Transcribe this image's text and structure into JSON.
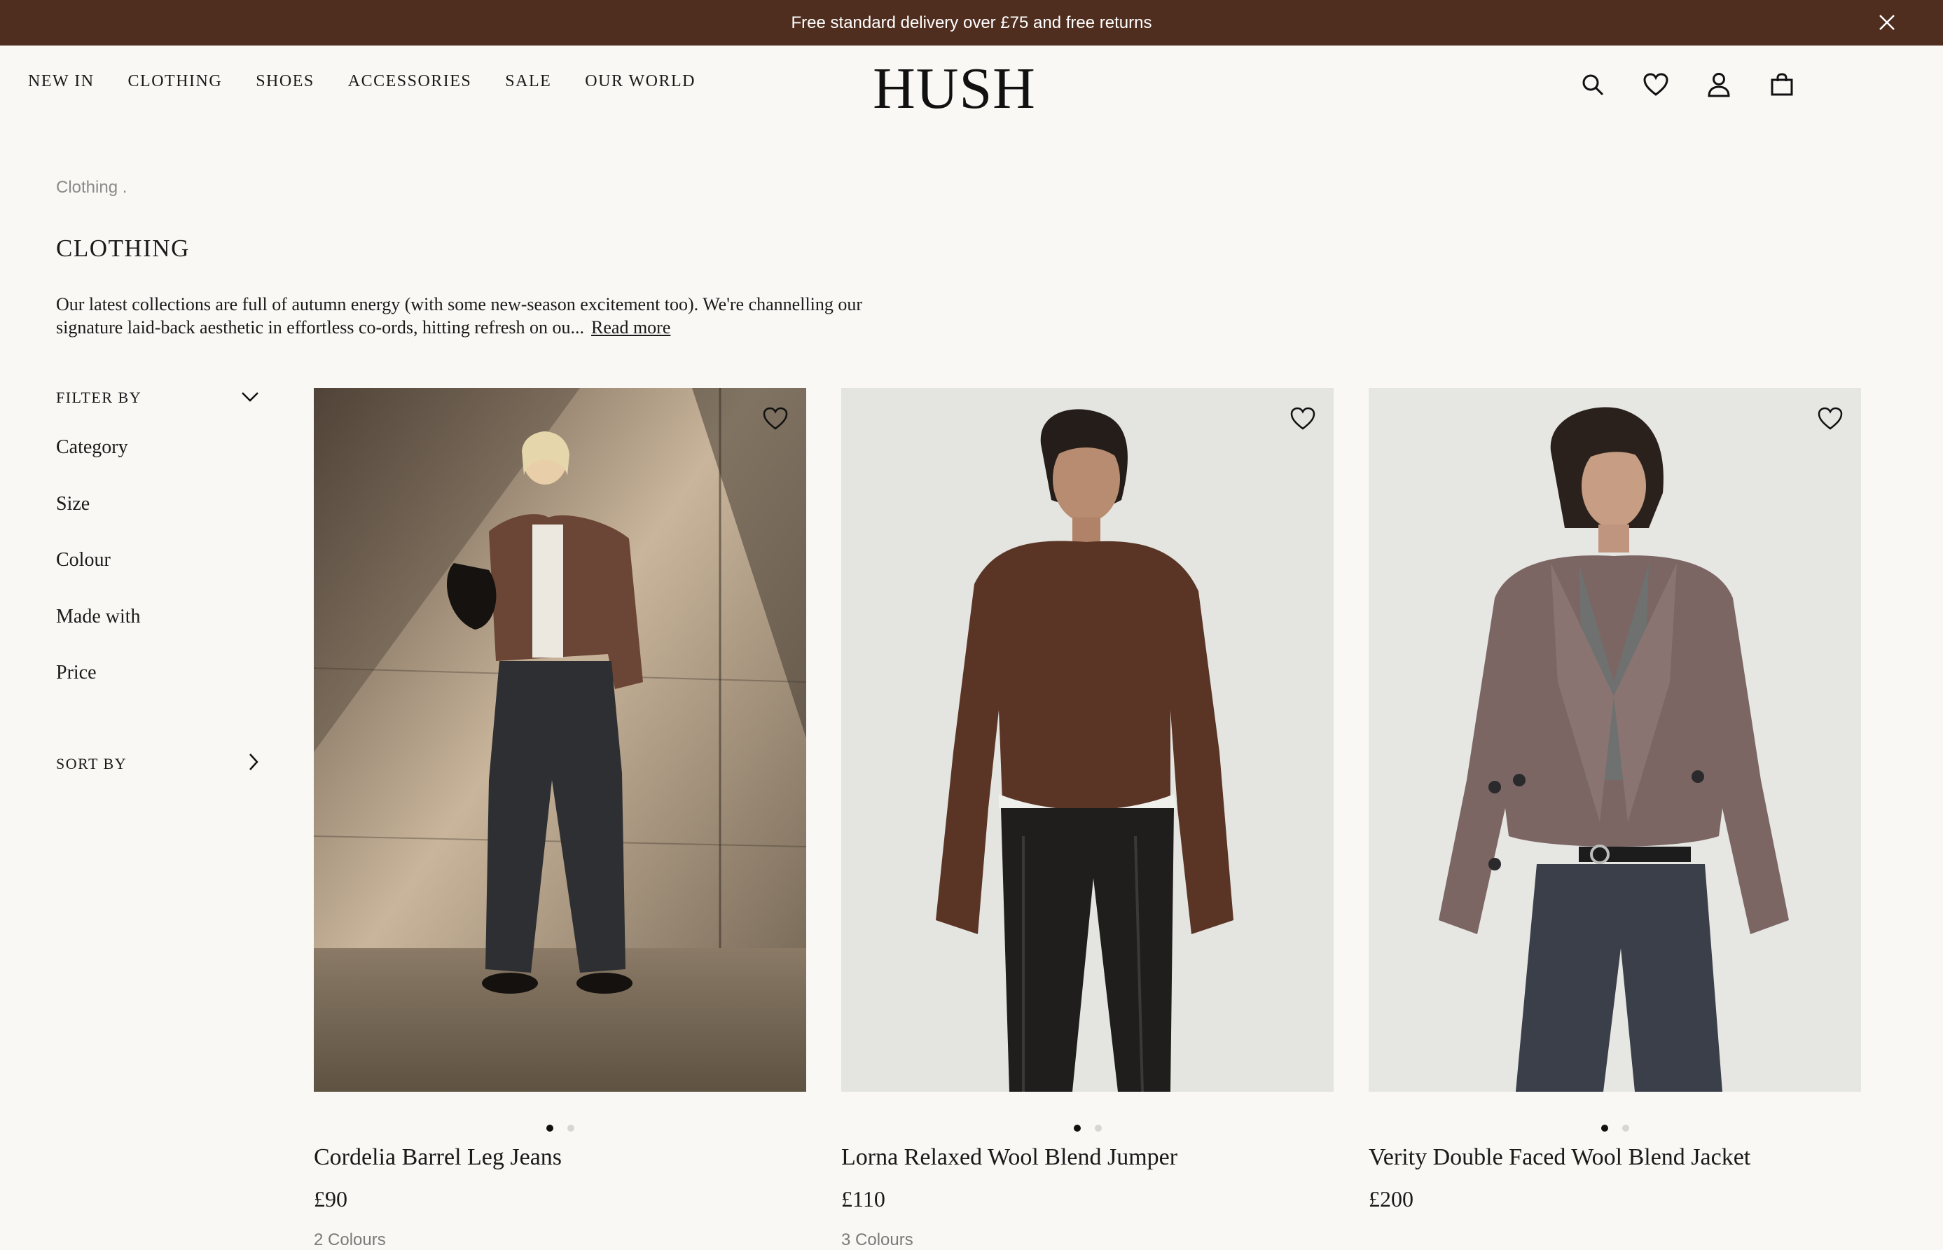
{
  "promo": {
    "text": "Free standard delivery over £75 and free returns"
  },
  "nav": {
    "items": [
      "NEW IN",
      "CLOTHING",
      "SHOES",
      "ACCESSORIES",
      "SALE",
      "OUR WORLD"
    ]
  },
  "brand": {
    "logo": "HUSH"
  },
  "breadcrumb": "Clothing .",
  "page": {
    "title": "CLOTHING",
    "intro": "Our latest collections are full of autumn energy (with some new-season excitement too). We're channelling our signature laid-back aesthetic in effortless co-ords, hitting refresh on ou...",
    "read_more": "Read more"
  },
  "filters": {
    "heading": "FILTER BY",
    "items": [
      "Category",
      "Size",
      "Colour",
      "Made with",
      "Price"
    ],
    "sort_heading": "SORT BY"
  },
  "products": [
    {
      "name": "Cordelia Barrel Leg Jeans",
      "price": "£90",
      "colours": "2 Colours"
    },
    {
      "name": "Lorna Relaxed Wool Blend Jumper",
      "price": "£110",
      "colours": "3 Colours"
    },
    {
      "name": "Verity Double Faced Wool Blend Jacket",
      "price": "£200",
      "colours": ""
    }
  ],
  "colors": {
    "promo_bg": "#4f2e1f",
    "page_bg": "#f9f8f5",
    "text": "#1a1a1a"
  },
  "icons": [
    "close-icon",
    "search-icon",
    "heart-icon",
    "account-icon",
    "bag-icon",
    "chevron-down-icon",
    "chevron-right-icon"
  ]
}
